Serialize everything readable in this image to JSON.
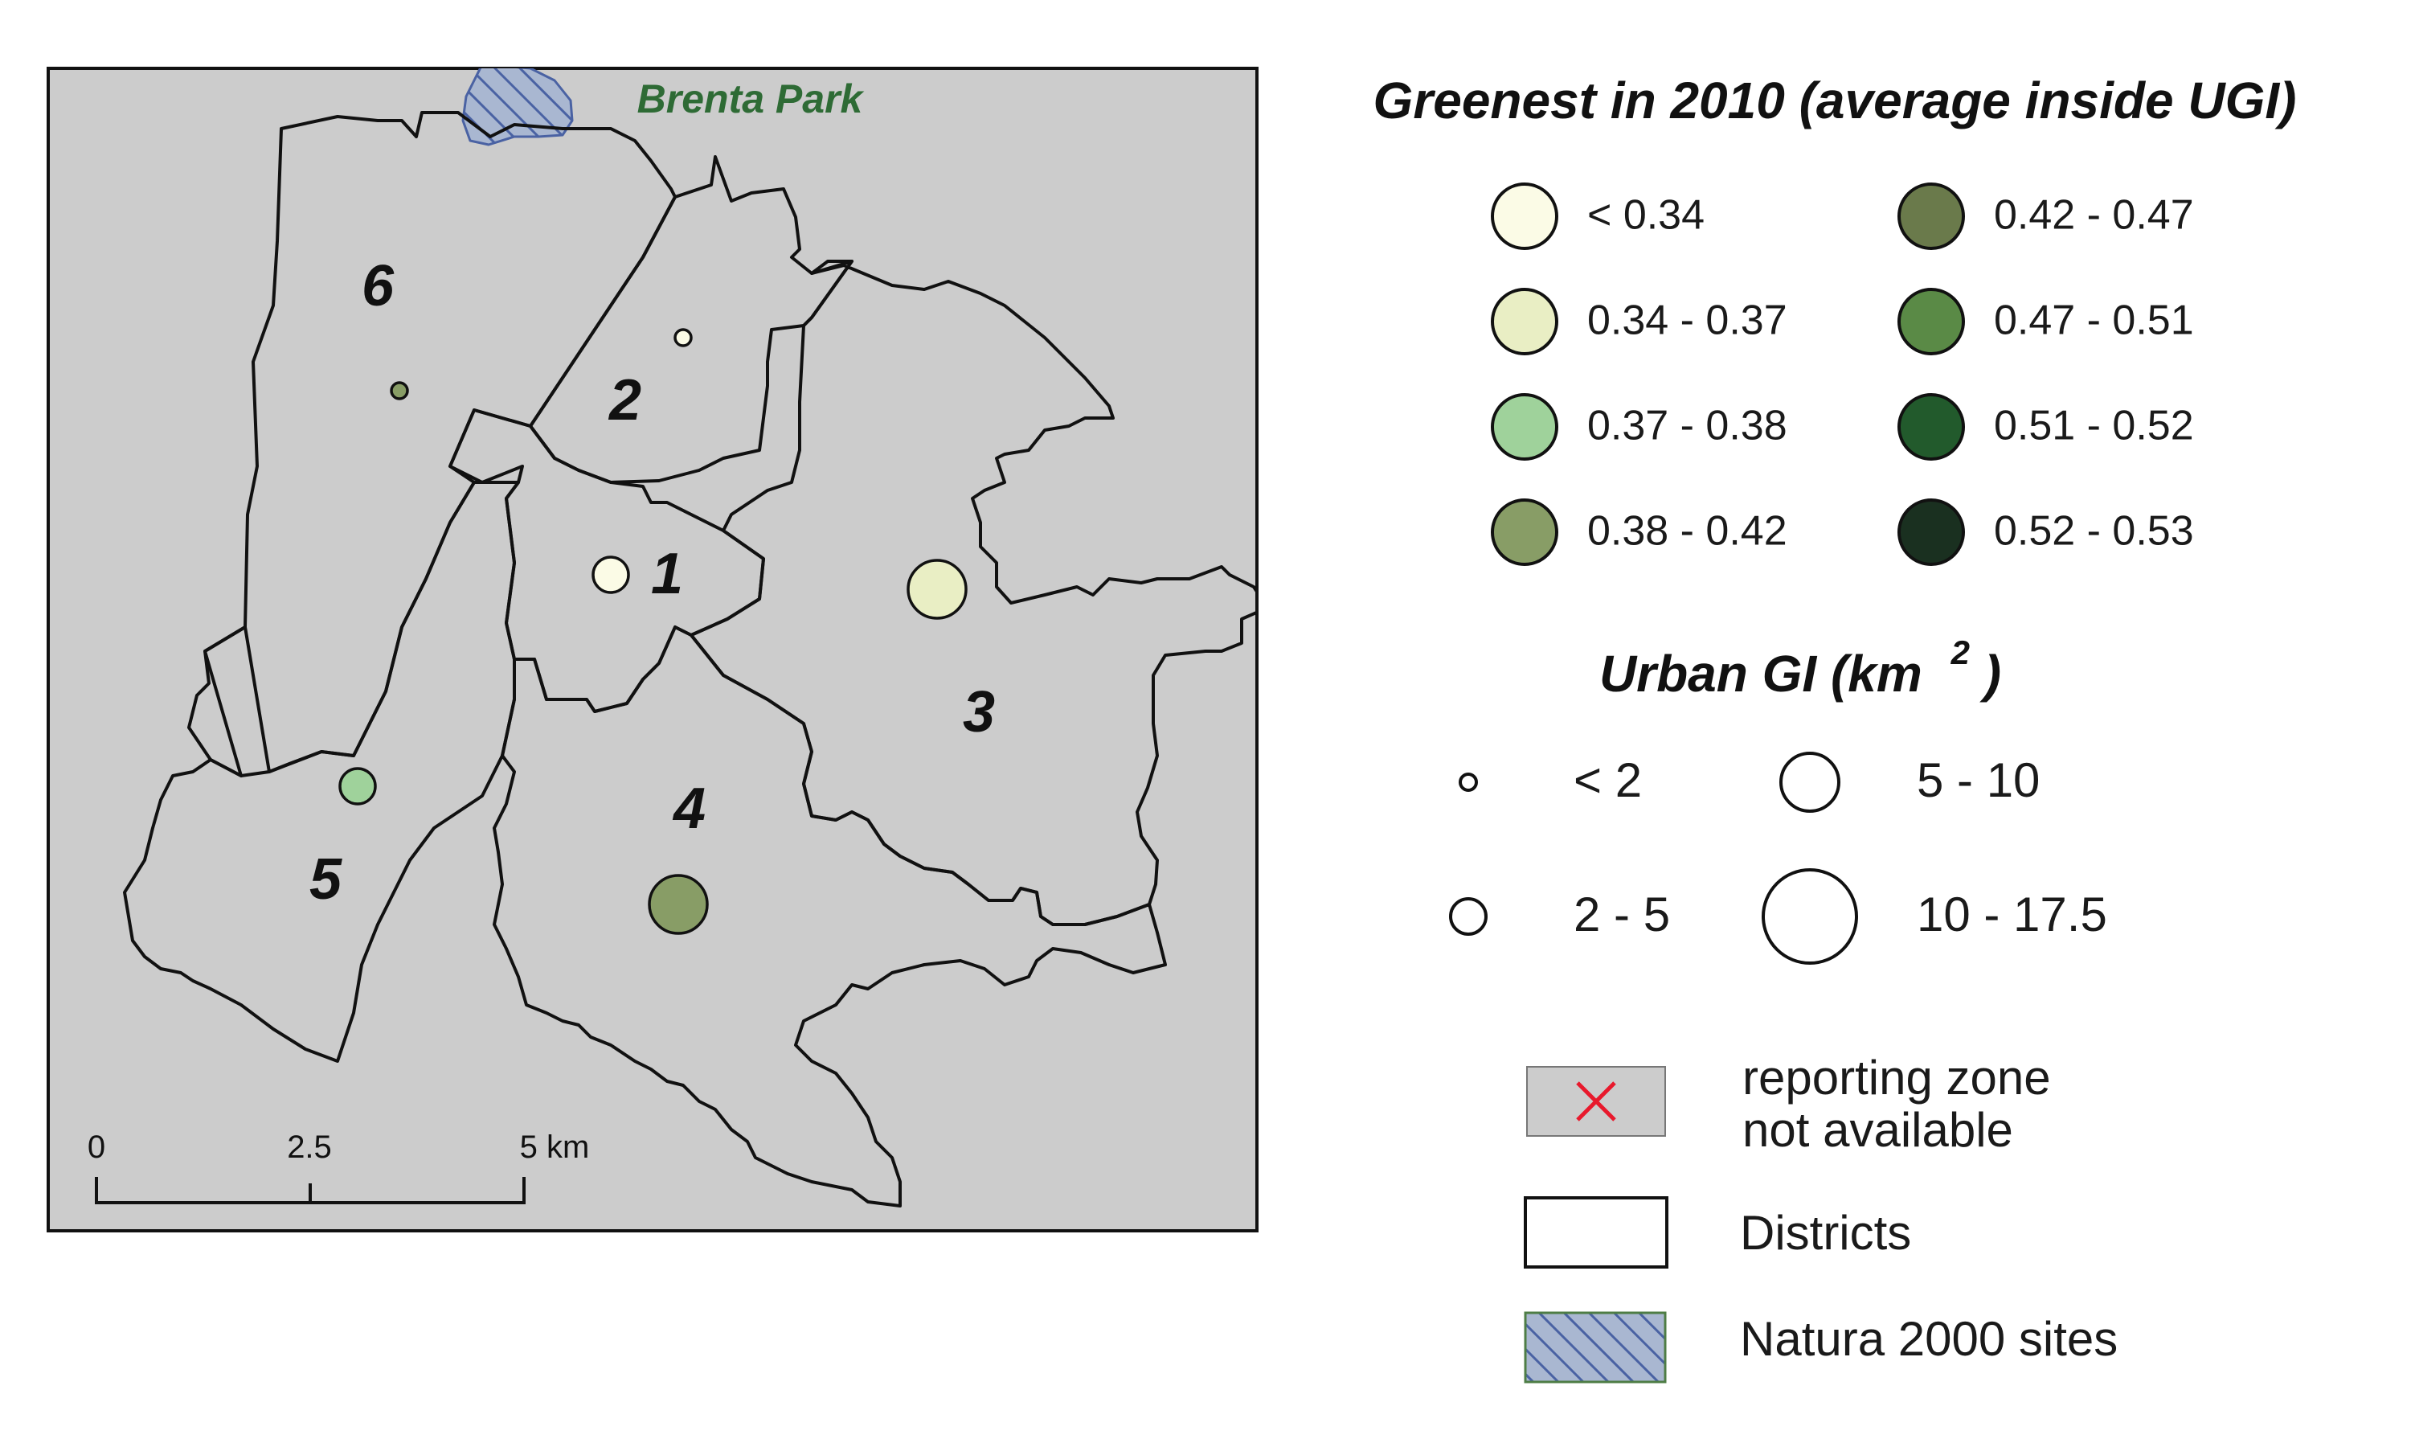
{
  "map": {
    "park_label": "Brenta Park",
    "districts": [
      {
        "id": "1",
        "label": "1",
        "greenness_class": "< 0.34",
        "ugi_class": "2 - 5"
      },
      {
        "id": "2",
        "label": "2",
        "greenness_class": "< 0.34",
        "ugi_class": "< 2"
      },
      {
        "id": "3",
        "label": "3",
        "greenness_class": "0.34 - 0.37",
        "ugi_class": "5 - 10"
      },
      {
        "id": "4",
        "label": "4",
        "greenness_class": "0.38 - 0.42",
        "ugi_class": "5 - 10"
      },
      {
        "id": "5",
        "label": "5",
        "greenness_class": "0.37 - 0.38",
        "ugi_class": "2 - 5"
      },
      {
        "id": "6",
        "label": "6",
        "greenness_class": "0.38 - 0.42",
        "ugi_class": "< 2"
      }
    ],
    "scale_bar": {
      "labels": [
        "0",
        "2.5",
        "5 km"
      ]
    },
    "colors": {
      "background": "#cccccc",
      "boundary": "#111111",
      "park_label": "#2e6b35",
      "natura_fill": "#a9b7d1",
      "natura_hatch": "#4a62a3",
      "not_available_cross": "#e8192c"
    }
  },
  "legend": {
    "greenness": {
      "title": "Greenest in 2010 (average inside UGI)",
      "classes": [
        {
          "label": "< 0.34",
          "color": "#fbfbe6"
        },
        {
          "label": "0.34 - 0.37",
          "color": "#e9eec4"
        },
        {
          "label": "0.37 - 0.38",
          "color": "#9fd29b"
        },
        {
          "label": "0.38 - 0.42",
          "color": "#889d66"
        },
        {
          "label": "0.42 - 0.47",
          "color": "#6a7a4b"
        },
        {
          "label": "0.47 - 0.51",
          "color": "#5a8a46"
        },
        {
          "label": "0.51 - 0.52",
          "color": "#225a2c"
        },
        {
          "label": "0.52 - 0.53",
          "color": "#1a3020"
        }
      ]
    },
    "ugi": {
      "title": "Urban GI (km",
      "title_sup": "2",
      "title_end": ")",
      "classes": [
        {
          "label": "< 2"
        },
        {
          "label": "5 - 10"
        },
        {
          "label": "2 - 5"
        },
        {
          "label": "10 - 17.5"
        }
      ]
    },
    "other": {
      "not_available_line1": "reporting zone",
      "not_available_line2": "not available",
      "districts": "Districts",
      "natura": "Natura 2000 sites"
    }
  }
}
